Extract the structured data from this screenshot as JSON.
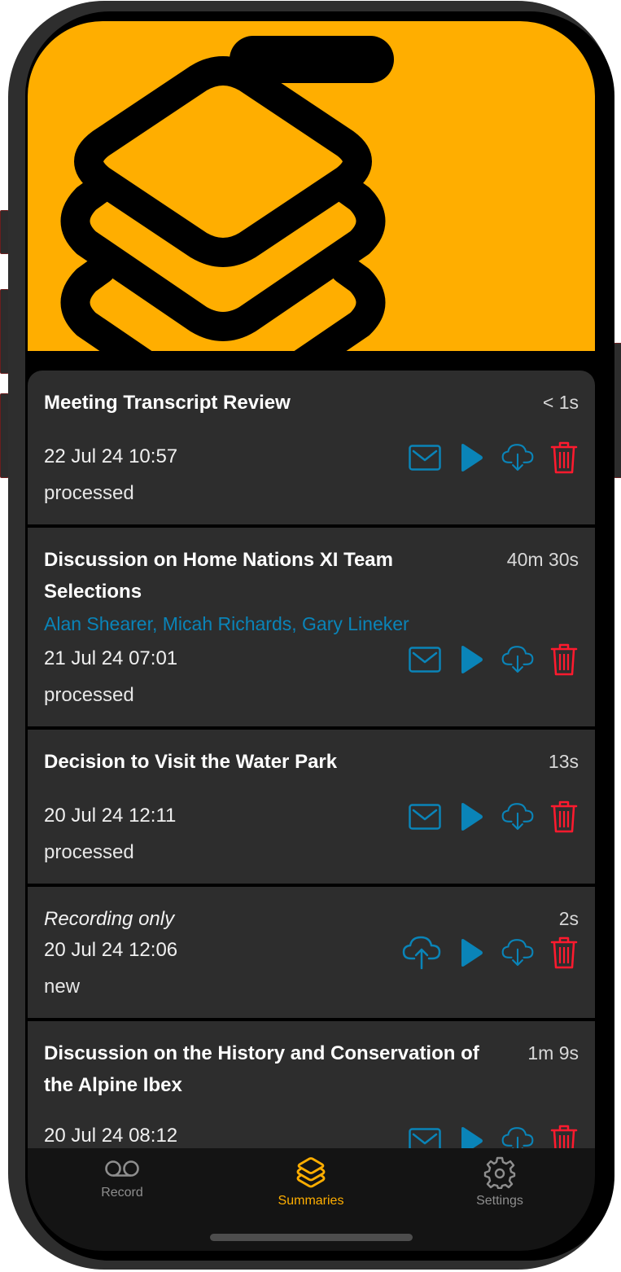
{
  "theme": {
    "accent": "#ffae00",
    "link": "#0a84b8",
    "danger": "#ff1a2e",
    "card_bg": "#2d2d2d",
    "tabbar_bg": "#141414"
  },
  "header": {
    "logo_icon": "stacked-layers-icon"
  },
  "recordings": [
    {
      "title": "Meeting Transcript Review",
      "title_style": "bold",
      "duration": "< 1s",
      "speakers": "",
      "date": "22 Jul 24 10:57",
      "status": "processed",
      "actions": [
        "email-icon",
        "play-icon",
        "cloud-download-icon",
        "trash-icon"
      ]
    },
    {
      "title": "Discussion on Home Nations XI Team Selections",
      "title_style": "bold",
      "duration": "40m 30s",
      "speakers": "Alan Shearer, Micah Richards, Gary Lineker",
      "date": "21 Jul 24 07:01",
      "status": "processed",
      "actions": [
        "email-icon",
        "play-icon",
        "cloud-download-icon",
        "trash-icon"
      ]
    },
    {
      "title": "Decision to Visit the Water Park",
      "title_style": "bold",
      "duration": "13s",
      "speakers": "",
      "date": "20 Jul 24 12:11",
      "status": "processed",
      "actions": [
        "email-icon",
        "play-icon",
        "cloud-download-icon",
        "trash-icon"
      ]
    },
    {
      "title": "Recording only",
      "title_style": "italic",
      "duration": "2s",
      "speakers": "",
      "date": "20 Jul 24 12:06",
      "status": "new",
      "actions": [
        "cloud-upload-icon",
        "play-icon",
        "cloud-download-icon",
        "trash-icon"
      ]
    },
    {
      "title": "Discussion on the History and Conservation of the Alpine Ibex",
      "title_style": "bold",
      "duration": "1m 9s",
      "speakers": "",
      "date": "20 Jul 24 08:12",
      "status": "",
      "actions": [
        "email-icon",
        "play-icon",
        "cloud-download-icon",
        "trash-icon"
      ]
    }
  ],
  "tabbar": {
    "tabs": [
      {
        "label": "Record",
        "icon": "voicemail-icon",
        "active": false
      },
      {
        "label": "Summaries",
        "icon": "stacked-layers-icon",
        "active": true
      },
      {
        "label": "Settings",
        "icon": "gear-icon",
        "active": false
      }
    ]
  }
}
